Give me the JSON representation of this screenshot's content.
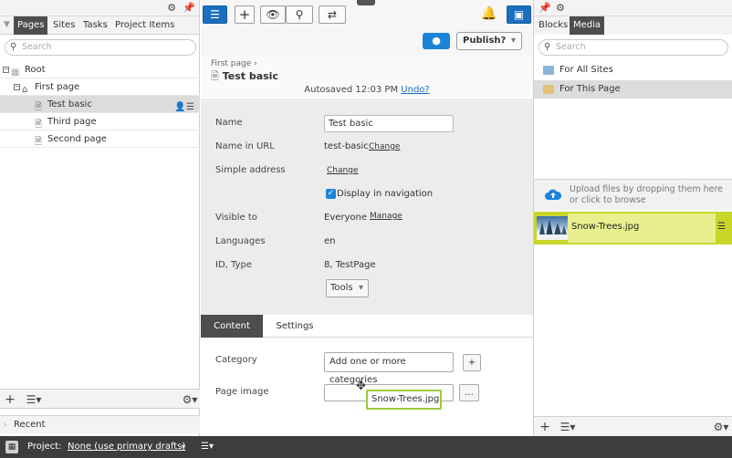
{
  "left_pane": {
    "tabs": [
      {
        "label": "Pages",
        "active": true
      },
      {
        "label": "Sites",
        "active": false
      },
      {
        "label": "Tasks",
        "active": false
      },
      {
        "label": "Project Items",
        "active": false
      }
    ],
    "search_placeholder": "Search",
    "tree": [
      {
        "label": "Root",
        "level": 0
      },
      {
        "label": "First page",
        "level": 1
      },
      {
        "label": "Test basic",
        "level": 2,
        "selected": true
      },
      {
        "label": "Third page",
        "level": 2
      },
      {
        "label": "Second page",
        "level": 2
      }
    ],
    "recent_label": "Recent"
  },
  "center_pane": {
    "publish_label": "Publish?",
    "breadcrumb": "First page",
    "page_title": "Test basic",
    "autosave_text": "Autosaved 12:03 PM",
    "undo_label": "Undo?",
    "properties": {
      "name_label": "Name",
      "name_value": "Test basic",
      "url_label": "Name in URL",
      "url_value": "test-basic",
      "change_label": "Change",
      "simple_address_label": "Simple address",
      "display_in_nav_label": "Display in navigation",
      "visible_to_label": "Visible to",
      "visible_to_value": "Everyone",
      "manage_label": "Manage",
      "languages_label": "Languages",
      "languages_value": "en",
      "id_type_label": "ID, Type",
      "id_type_value": "8, TestPage",
      "tools_label": "Tools"
    },
    "content_tabs": [
      {
        "label": "Content",
        "active": true
      },
      {
        "label": "Settings",
        "active": false
      }
    ],
    "category_label": "Category",
    "category_placeholder": "Add one or more categories",
    "add_button": "+",
    "page_image_label": "Page image",
    "browse_button": "...",
    "drag_tooltip": "Snow-Trees.jpg"
  },
  "right_pane": {
    "tabs": [
      {
        "label": "Blocks",
        "active": false
      },
      {
        "label": "Media",
        "active": true
      }
    ],
    "search_placeholder": "Search",
    "folders": [
      {
        "label": "For All Sites",
        "selected": false
      },
      {
        "label": "For This Page",
        "selected": true
      }
    ],
    "upload_hint": "Upload files by dropping them here or click to browse",
    "media_items": [
      {
        "label": "Snow-Trees.jpg"
      }
    ]
  },
  "status_bar": {
    "project_label": "Project:",
    "project_value": "None (use primary drafts)"
  },
  "colors": {
    "accent_blue": "#1b6fc0",
    "dark_tab": "#4d4d4d",
    "media_highlight": "#c8d62a",
    "tooltip_border": "#9cc93a",
    "status_bar": "#3d3d3d"
  }
}
